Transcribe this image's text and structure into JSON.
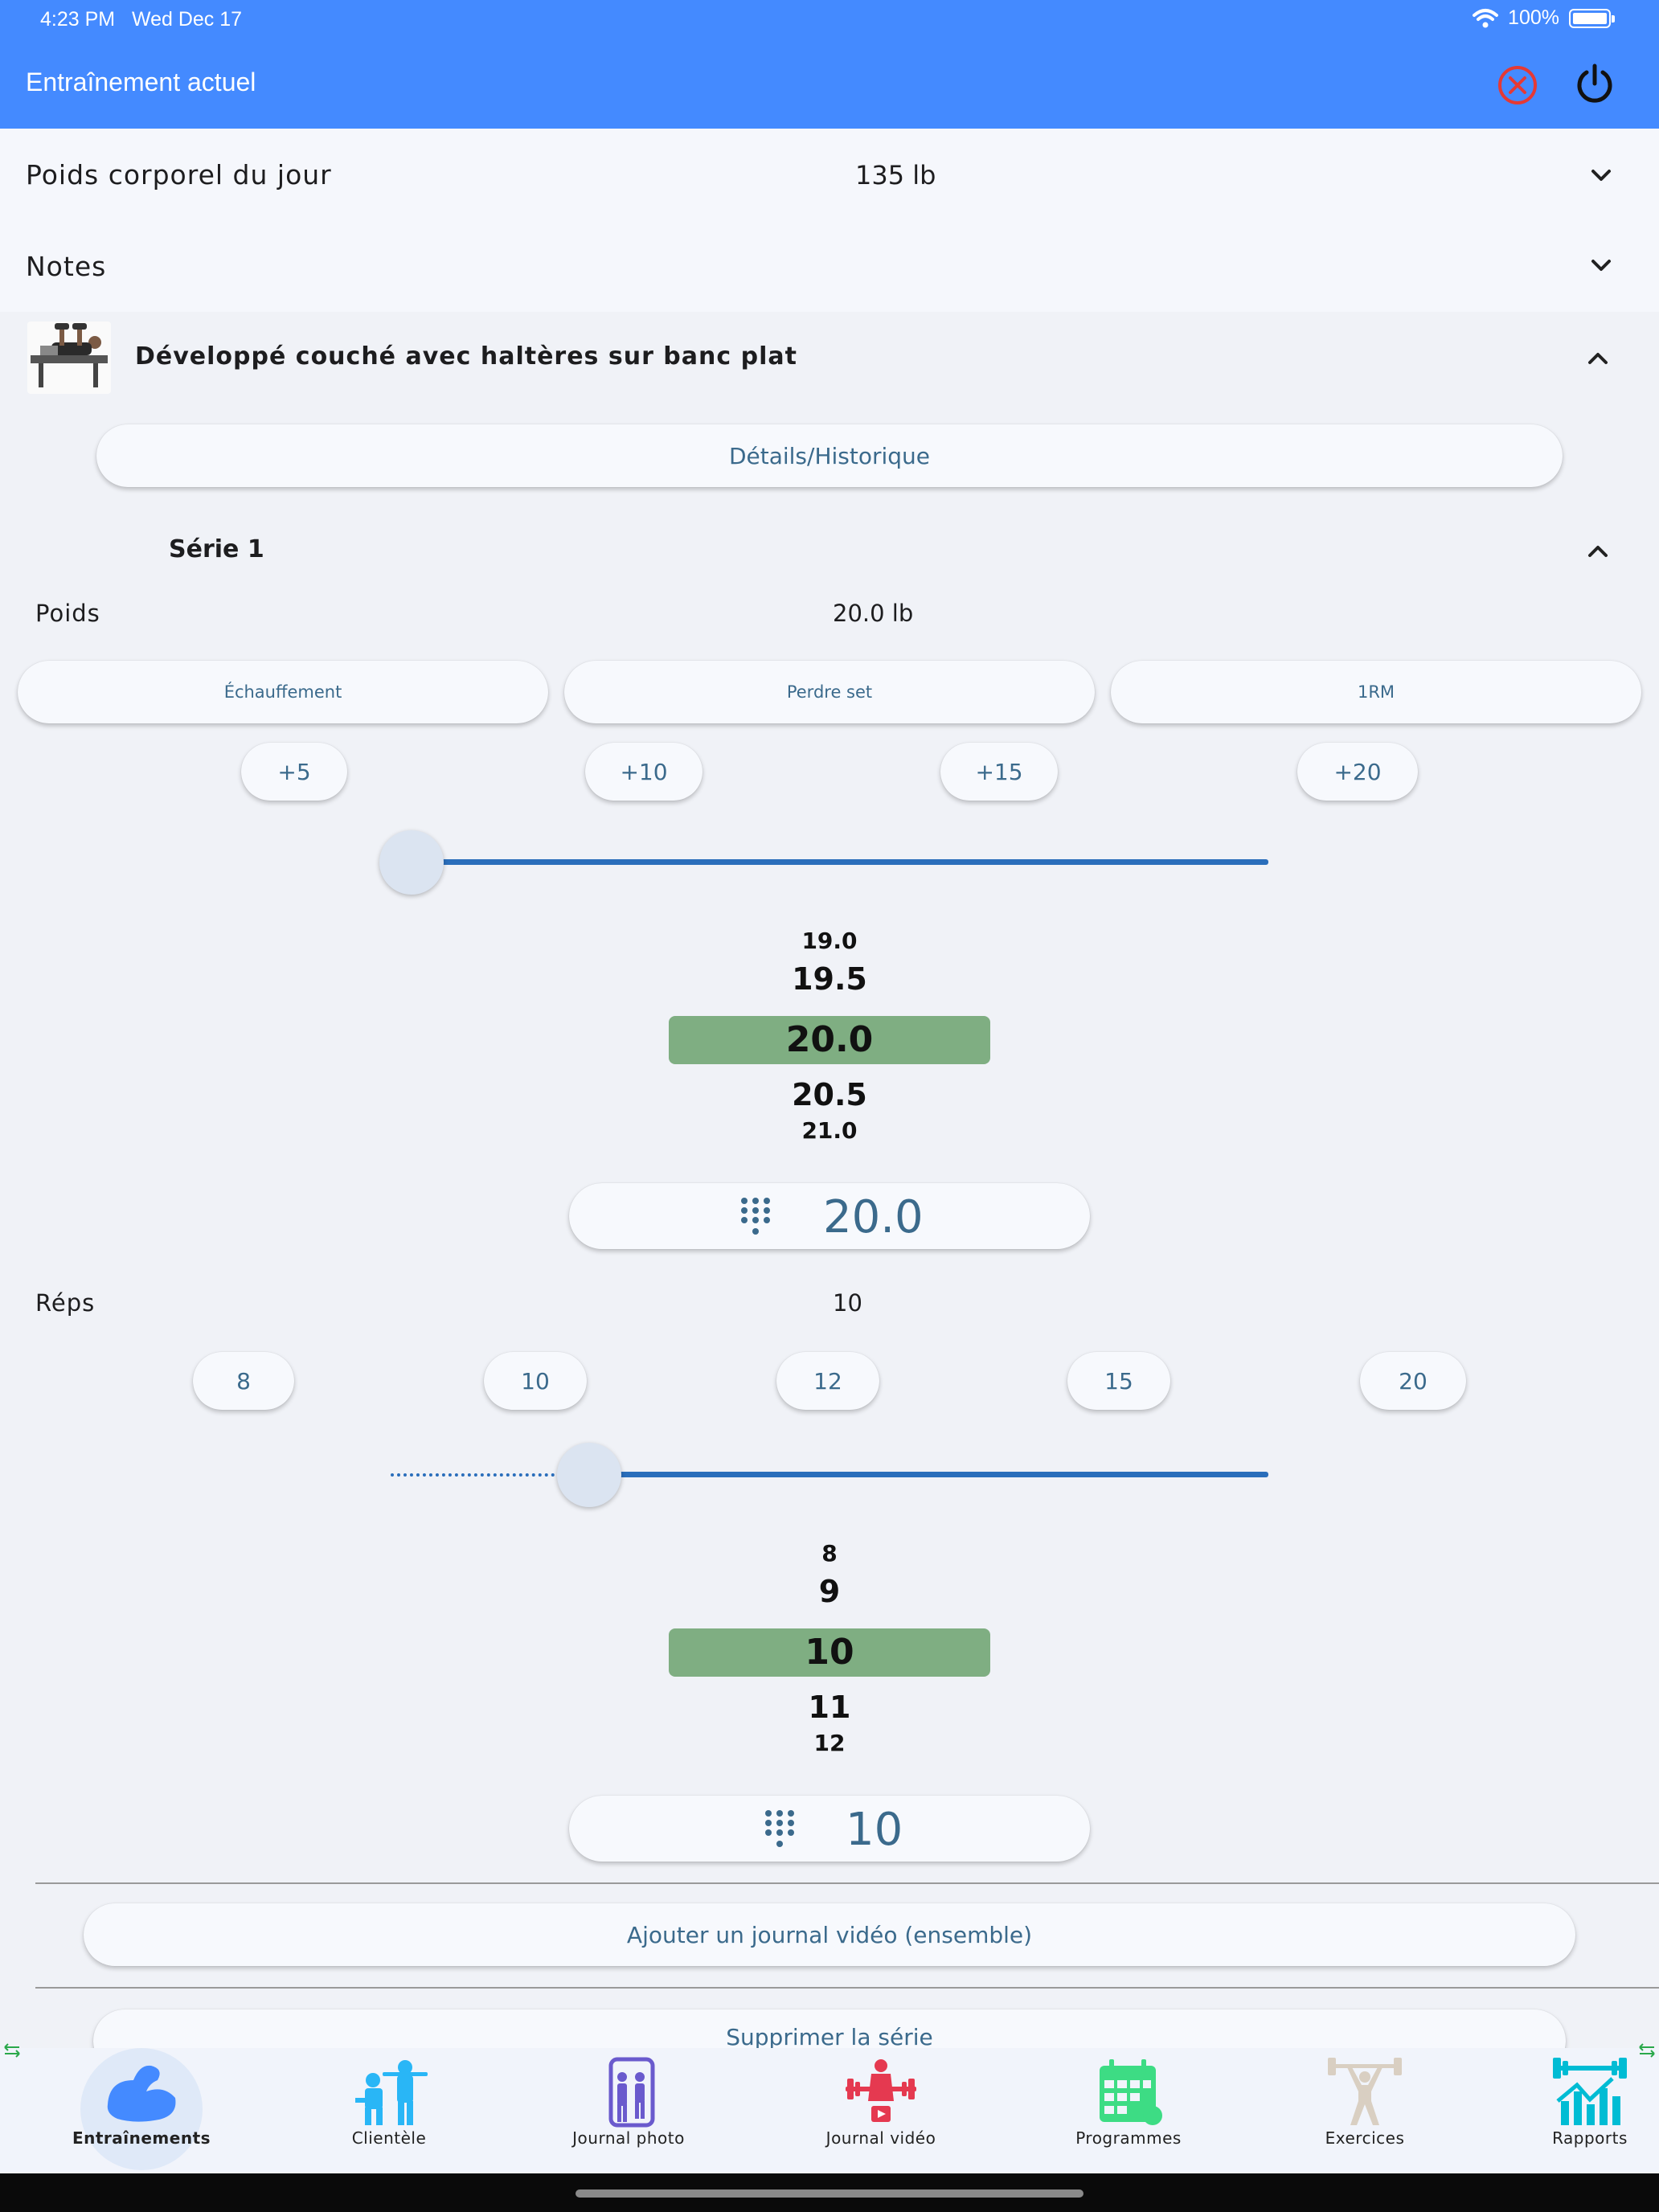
{
  "status_bar": {
    "time": "4:23 PM",
    "date": "Wed Dec 17",
    "battery": "100%"
  },
  "app_bar": {
    "title": "Entraînement actuel"
  },
  "body_weight": {
    "label": "Poids corporel du jour",
    "value": "135 lb"
  },
  "notes": {
    "label": "Notes"
  },
  "exercise": {
    "name": "Développé couché avec haltères sur banc plat",
    "details_button": "Détails/Historique",
    "set": {
      "title": "Série 1",
      "weight": {
        "label": "Poids",
        "value": "20.0 lb",
        "type_buttons": [
          "Échauffement",
          "Perdre set",
          "1RM"
        ],
        "increments": [
          "+5",
          "+10",
          "+15",
          "+20"
        ],
        "slider_fraction": 0.0,
        "wheel": [
          "19.0",
          "19.5",
          "20.0",
          "20.5",
          "21.0"
        ],
        "entry_value": "20.0"
      },
      "reps": {
        "label": "Réps",
        "value": "10",
        "presets": [
          "8",
          "10",
          "12",
          "15",
          "20"
        ],
        "slider_fraction": 0.2,
        "wheel": [
          "8",
          "9",
          "10",
          "11",
          "12"
        ],
        "entry_value": "10"
      },
      "add_video_button": "Ajouter un journal vidéo (ensemble)",
      "delete_set_button": "Supprimer la série"
    }
  },
  "bottom_nav": [
    {
      "label": "Entraînements",
      "icon": "bicep-icon",
      "active": true
    },
    {
      "label": "Clientèle",
      "icon": "clients-icon",
      "active": false
    },
    {
      "label": "Journal photo",
      "icon": "photo-journal-icon",
      "active": false
    },
    {
      "label": "Journal vidéo",
      "icon": "video-journal-icon",
      "active": false
    },
    {
      "label": "Programmes",
      "icon": "calendar-icon",
      "active": false
    },
    {
      "label": "Exercices",
      "icon": "weightlifter-icon",
      "active": false
    },
    {
      "label": "Rapports",
      "icon": "reports-icon",
      "active": false
    }
  ],
  "colors": {
    "app_bar": "#448aff",
    "accent_text": "#3b6a8c",
    "slider": "#2a6ebb",
    "wheel_selected": "#7fae82",
    "close_icon": "#e53935"
  }
}
